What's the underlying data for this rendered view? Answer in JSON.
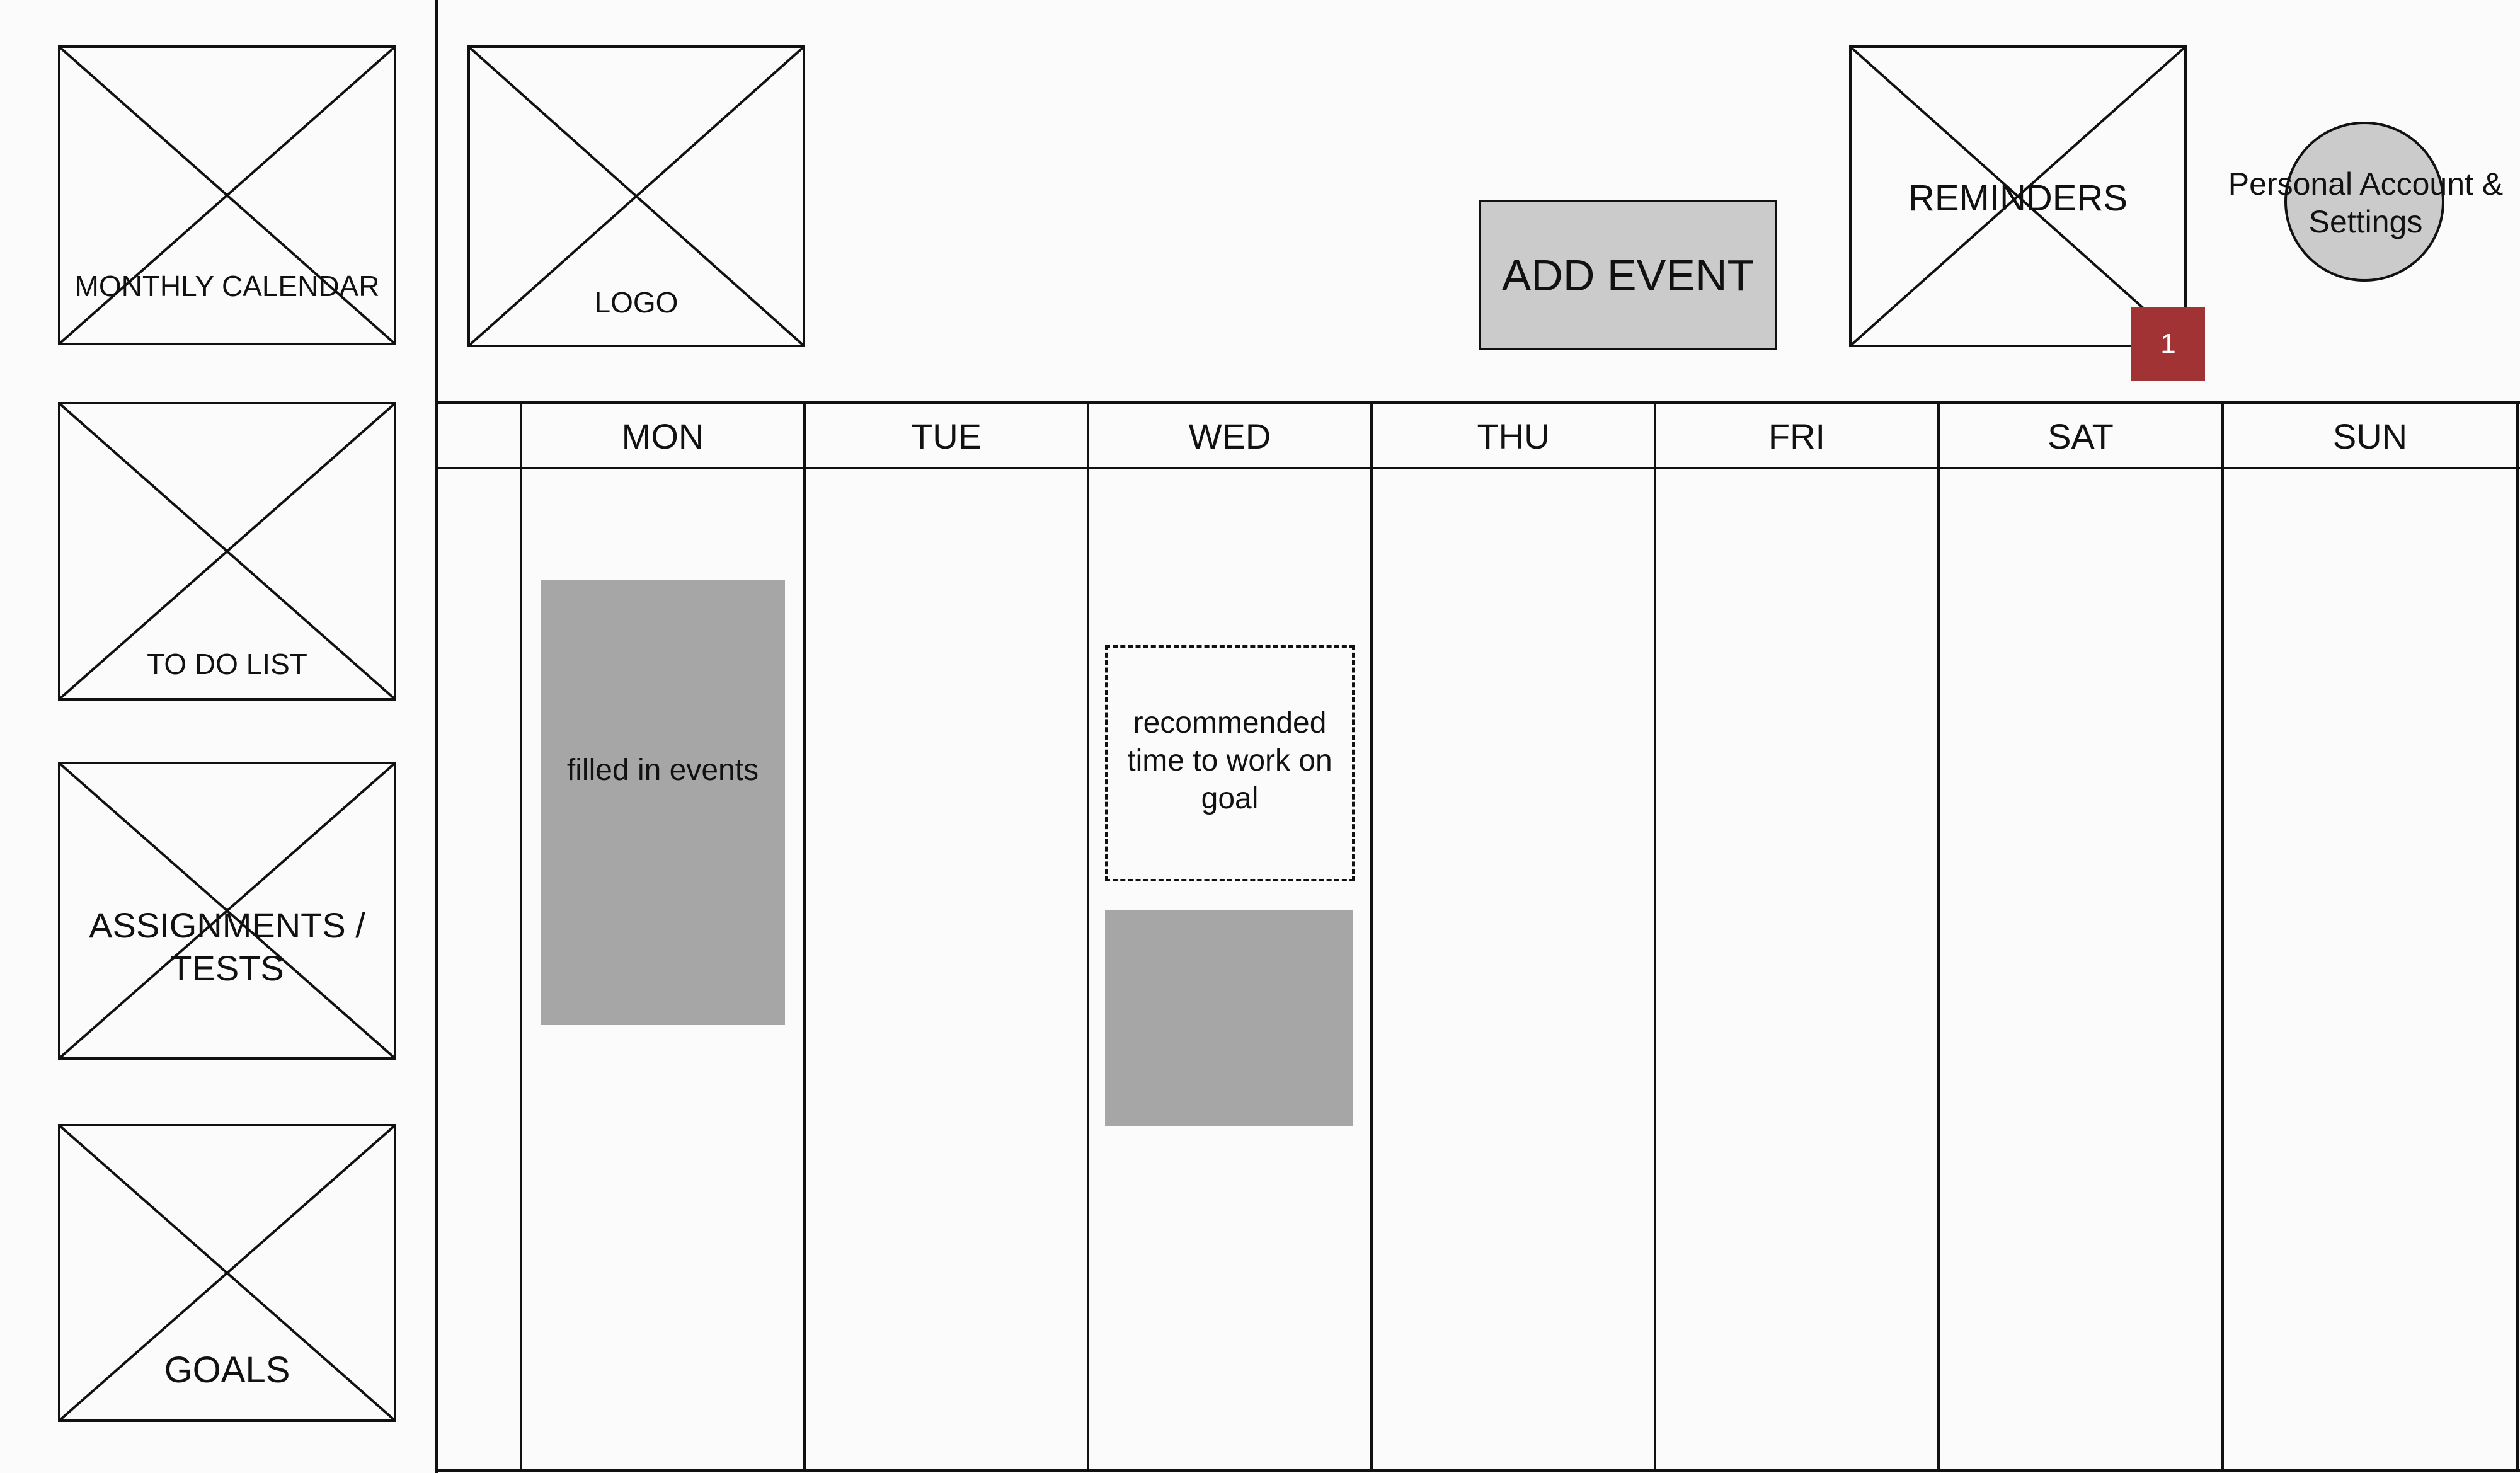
{
  "sidebar": {
    "items": [
      {
        "label": "MONTHLY CALENDAR"
      },
      {
        "label": "TO DO LIST"
      },
      {
        "label": "ASSIGNMENTS / TESTS"
      },
      {
        "label": "GOALS"
      }
    ]
  },
  "header": {
    "logo_label": "LOGO",
    "add_event_label": "ADD EVENT",
    "reminders_label": "REMINDERS",
    "reminders_count": "1",
    "account_label": "Personal Account & Settings"
  },
  "calendar": {
    "days": [
      "MON",
      "TUE",
      "WED",
      "THU",
      "FRI",
      "SAT",
      "SUN"
    ],
    "events": [
      {
        "day": "MON",
        "label": "filled in events",
        "style": "filled"
      },
      {
        "day": "WED",
        "label": "recommended time to work on goal",
        "style": "recommended"
      },
      {
        "day": "WED",
        "label": "",
        "style": "filled"
      }
    ]
  },
  "colors": {
    "badge": "#a23334",
    "event_fill": "#a6a6a6",
    "button_fill": "#cbcbcb"
  }
}
